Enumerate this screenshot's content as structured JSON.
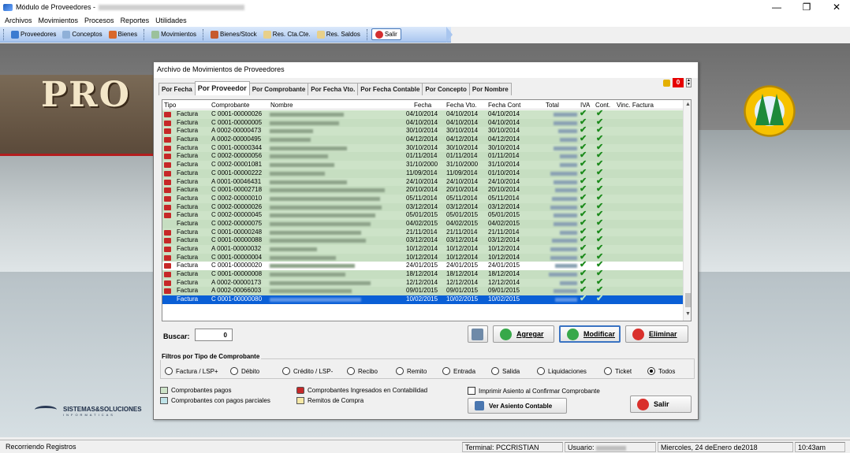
{
  "window": {
    "title": "Módulo de Proveedores -",
    "controls": [
      "—",
      "❐",
      "✕"
    ]
  },
  "menu": [
    "Archivos",
    "Movimientos",
    "Procesos",
    "Reportes",
    "Utilidades"
  ],
  "toolbar": {
    "proveedores": "Proveedores",
    "conceptos": "Conceptos",
    "bienes": "Bienes",
    "movimientos": "Movimientos",
    "bienes_stock": "Bienes/Stock",
    "res_cta_cte": "Res. Cta.Cte.",
    "res_saldos": "Res. Saldos",
    "salir": "Salir"
  },
  "background": {
    "brand": "PRO"
  },
  "dialog": {
    "title": "Archivo de Movimientos de Proveedores",
    "tabs": [
      "Por Fecha",
      "Por Proveedor",
      "Por Comprobante",
      "Por Fecha Vto.",
      "Por Fecha Contable",
      "Por Concepto",
      "Por Nombre"
    ],
    "active_tab": "Por Proveedor",
    "counter": "0",
    "columns": [
      "Tipo",
      "Comprobante",
      "Nombre",
      "Fecha",
      "Fecha Vto.",
      "Fecha Cont",
      "Total",
      "IVA",
      "Cont.",
      "Vinc. Factura"
    ],
    "rows": [
      {
        "tipo": "Factura",
        "comp": "C 0001-00000026",
        "fecha": "04/10/2014",
        "vto": "04/10/2014",
        "cont": "04/10/2014",
        "icon": true
      },
      {
        "tipo": "Factura",
        "comp": "C 0001-00000005",
        "fecha": "04/10/2014",
        "vto": "04/10/2014",
        "cont": "04/10/2014",
        "icon": true
      },
      {
        "tipo": "Factura",
        "comp": "A 0002-00000473",
        "fecha": "30/10/2014",
        "vto": "30/10/2014",
        "cont": "30/10/2014",
        "icon": true
      },
      {
        "tipo": "Factura",
        "comp": "A 0002-00000495",
        "fecha": "04/12/2014",
        "vto": "04/12/2014",
        "cont": "04/12/2014",
        "icon": true
      },
      {
        "tipo": "Factura",
        "comp": "C 0001-00000344",
        "fecha": "30/10/2014",
        "vto": "30/10/2014",
        "cont": "30/10/2014",
        "icon": true
      },
      {
        "tipo": "Factura",
        "comp": "C 0002-00000056",
        "fecha": "01/11/2014",
        "vto": "01/11/2014",
        "cont": "01/11/2014",
        "icon": true
      },
      {
        "tipo": "Factura",
        "comp": "C 0002-00001081",
        "fecha": "31/10/2000",
        "vto": "31/10/2000",
        "cont": "31/10/2014",
        "icon": true
      },
      {
        "tipo": "Factura",
        "comp": "C 0001-00000222",
        "fecha": "11/09/2014",
        "vto": "11/09/2014",
        "cont": "01/10/2014",
        "icon": true
      },
      {
        "tipo": "Factura",
        "comp": "A 0001-00046431",
        "fecha": "24/10/2014",
        "vto": "24/10/2014",
        "cont": "24/10/2014",
        "icon": true
      },
      {
        "tipo": "Factura",
        "comp": "C 0001-00002718",
        "fecha": "20/10/2014",
        "vto": "20/10/2014",
        "cont": "20/10/2014",
        "icon": true
      },
      {
        "tipo": "Factura",
        "comp": "C 0002-00000010",
        "fecha": "05/11/2014",
        "vto": "05/11/2014",
        "cont": "05/11/2014",
        "icon": true
      },
      {
        "tipo": "Factura",
        "comp": "C 0002-00000026",
        "fecha": "03/12/2014",
        "vto": "03/12/2014",
        "cont": "03/12/2014",
        "icon": true
      },
      {
        "tipo": "Factura",
        "comp": "C 0002-00000045",
        "fecha": "05/01/2015",
        "vto": "05/01/2015",
        "cont": "05/01/2015",
        "icon": true
      },
      {
        "tipo": "Factura",
        "comp": "C 0002-00000075",
        "fecha": "04/02/2015",
        "vto": "04/02/2015",
        "cont": "04/02/2015",
        "icon": false
      },
      {
        "tipo": "Factura",
        "comp": "C 0001-00000248",
        "fecha": "21/11/2014",
        "vto": "21/11/2014",
        "cont": "21/11/2014",
        "icon": true
      },
      {
        "tipo": "Factura",
        "comp": "C 0001-00000088",
        "fecha": "03/12/2014",
        "vto": "03/12/2014",
        "cont": "03/12/2014",
        "icon": true
      },
      {
        "tipo": "Factura",
        "comp": "A 0001-00000032",
        "fecha": "10/12/2014",
        "vto": "10/12/2014",
        "cont": "10/12/2014",
        "icon": true
      },
      {
        "tipo": "Factura",
        "comp": "C 0001-00000004",
        "fecha": "10/12/2014",
        "vto": "10/12/2014",
        "cont": "10/12/2014",
        "icon": true
      },
      {
        "tipo": "Factura",
        "comp": "C 0001-00000020",
        "fecha": "24/01/2015",
        "vto": "24/01/2015",
        "cont": "24/01/2015",
        "icon": true,
        "white": true
      },
      {
        "tipo": "Factura",
        "comp": "C 0001-00000008",
        "fecha": "18/12/2014",
        "vto": "18/12/2014",
        "cont": "18/12/2014",
        "icon": true
      },
      {
        "tipo": "Factura",
        "comp": "A 0002-00000173",
        "fecha": "12/12/2014",
        "vto": "12/12/2014",
        "cont": "12/12/2014",
        "icon": true
      },
      {
        "tipo": "Factura",
        "comp": "A 0002-00066003",
        "fecha": "09/01/2015",
        "vto": "09/01/2015",
        "cont": "09/01/2015",
        "icon": true
      },
      {
        "tipo": "Factura",
        "comp": "C 0001-00000080",
        "fecha": "10/02/2015",
        "vto": "10/02/2015",
        "cont": "10/02/2015",
        "icon": false,
        "selected": true
      }
    ],
    "buscar_label": "Buscar:",
    "buscar_value": "0",
    "btn_agregar": "Agregar",
    "btn_modificar": "Modificar",
    "btn_eliminar": "Eliminar",
    "filters_title": "Filtros por Tipo de Comprobante",
    "filters": [
      "Factura / LSP+",
      "Débito",
      "Crédito / LSP-",
      "Recibo",
      "Remito",
      "Entrada",
      "Salida",
      "Liquidaciones",
      "Ticket",
      "Todos"
    ],
    "filter_selected": "Todos",
    "legend_pagados": "Comprobantes pagos",
    "legend_parciales": "Comprobantes con pagos parciales",
    "legend_contabilidad": "Comprobantes Ingresados en Contabilidad",
    "legend_remitos": "Remitos de Compra",
    "imprimir_asiento": "Imprimir Asiento al Confirmar Comprobante",
    "btn_ver_asiento": "Ver Asiento Contable",
    "btn_salir": "Salir"
  },
  "sidebar_brand": {
    "name": "SISTEMAS&SOLUCIONES",
    "sub": "INFORMATICAS"
  },
  "statusbar": {
    "status": "Recorriendo Registros",
    "terminal": "Terminal: PCCRISTIAN",
    "usuario": "Usuario:",
    "fecha": "Miercoles, 24 deEnero de2018",
    "hora": "10:43am"
  },
  "colors": {
    "paid_green": "#cde3c8",
    "partial_blue": "#bfe3e8",
    "remito_yellow": "#f6e8a6",
    "selection": "#0a5fd6",
    "counter_red": "#e60000"
  }
}
